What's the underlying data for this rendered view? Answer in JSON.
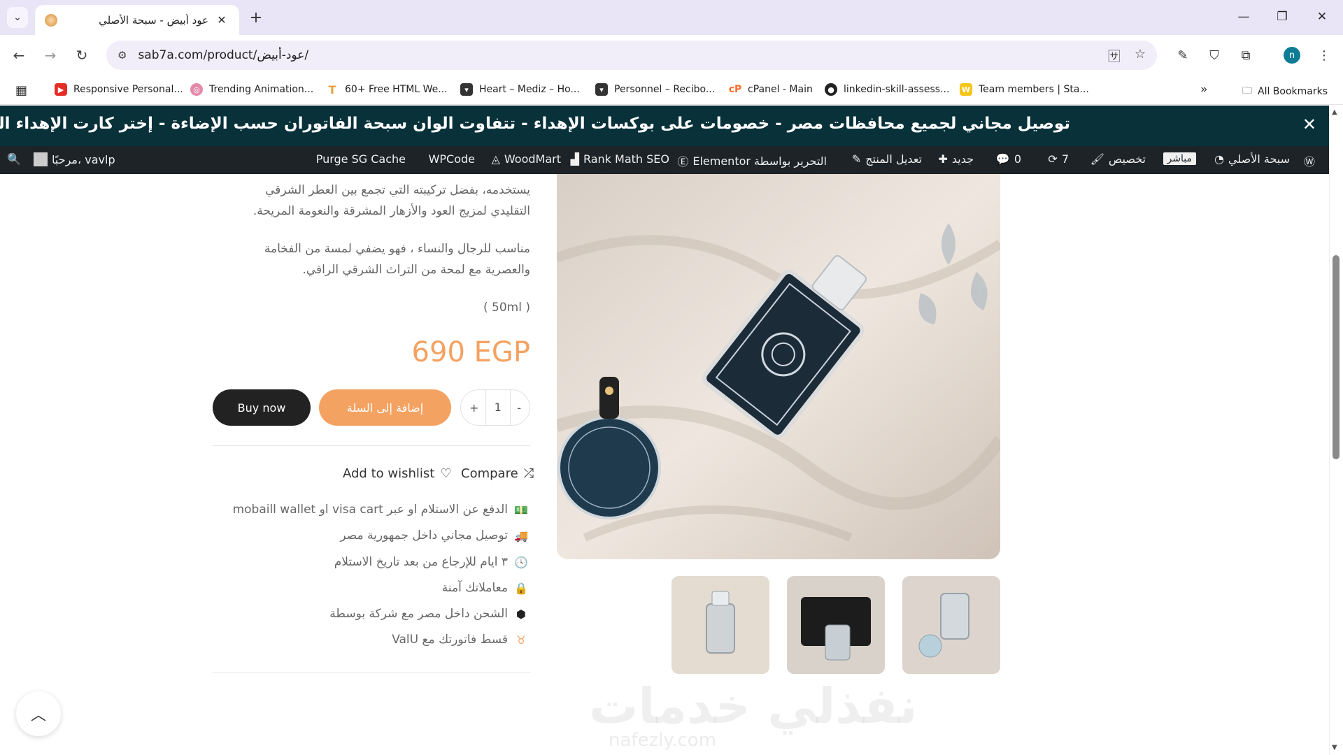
{
  "browser": {
    "tab_title": "عود أبيض - سبحة الأصلي",
    "url": "sab7a.com/product/عود-أبيض/",
    "profile_initial": "n",
    "bookmarks": [
      "Responsive Personal...",
      "Trending Animation...",
      "60+ Free HTML We...",
      "Heart – Mediz – Ho...",
      "Personnel – Recibo...",
      "cPanel - Main",
      "linkedin-skill-assess...",
      "Team members | Sta..."
    ],
    "all_bookmarks": "All Bookmarks"
  },
  "announcement": "توصيل مجاني لجميع محافظات مصر  -  خصومات على بوكسات الإهداء - تتفاوت الوان سبحة الفاتوران حسب الإضاءة - إختر كارت الإهداء المناسب لك واضف طابعك الشخصي",
  "adminbar": {
    "site_name": "سبحة الأصلي",
    "live": "مباشر",
    "customize": "تخصيص",
    "updates": "7",
    "comments": "0",
    "new": "جديد",
    "edit_product": "تعديل المنتج",
    "elementor": "Elementor التحرير بواسطة",
    "rank_math": "Rank Math SEO",
    "woodmart": "WoodMart",
    "wpcode": "WPCode",
    "purge": "Purge SG Cache",
    "greeting": "مرحبًا، vavlp"
  },
  "product": {
    "desc_line1": "يستخدمه، بفضل تركيبته التي تجمع بين العطر الشرقي",
    "desc_line2": "التقليدي لمزيج العود والأزهار المشرقة والنعومة المريحة.",
    "desc_line3": "مناسب للرجال والنساء ، فهو يضفي لمسة من الفخامة",
    "desc_line4": "والعصرية مع لمحة من التراث الشرقي الراقي.",
    "size": "( 50ml )",
    "price": "690 EGP",
    "buy_now": "Buy now",
    "add_to_cart": "إضافة إلى السلة",
    "quantity": "1",
    "qty_plus": "+",
    "qty_minus": "-",
    "wishlist": "Add to wishlist",
    "compare": "Compare"
  },
  "features": [
    {
      "icon": "cash-icon",
      "text": "الدفع عن الاستلام او عبر visa cart او mobaill wallet"
    },
    {
      "icon": "truck-icon",
      "text": "توصيل مجاني داخل جمهورية مصر"
    },
    {
      "icon": "clock-icon",
      "text": "٣ ايام للإرجاع من بعد تاريخ الاستلام"
    },
    {
      "icon": "lock-icon",
      "text": "معاملاتك آمنة"
    },
    {
      "icon": "box-icon",
      "text": "الشحن داخل مصر مع شركة بوسطة"
    },
    {
      "icon": "valu-icon",
      "text": "قسط فاتورتك مع ValU"
    }
  ],
  "watermark": "نفذلي خدمات",
  "watermark_sub": "nafezly.com",
  "colors": {
    "accent": "#f4a261",
    "announce_bg": "#08313a",
    "adminbar_bg": "#1d2327"
  }
}
